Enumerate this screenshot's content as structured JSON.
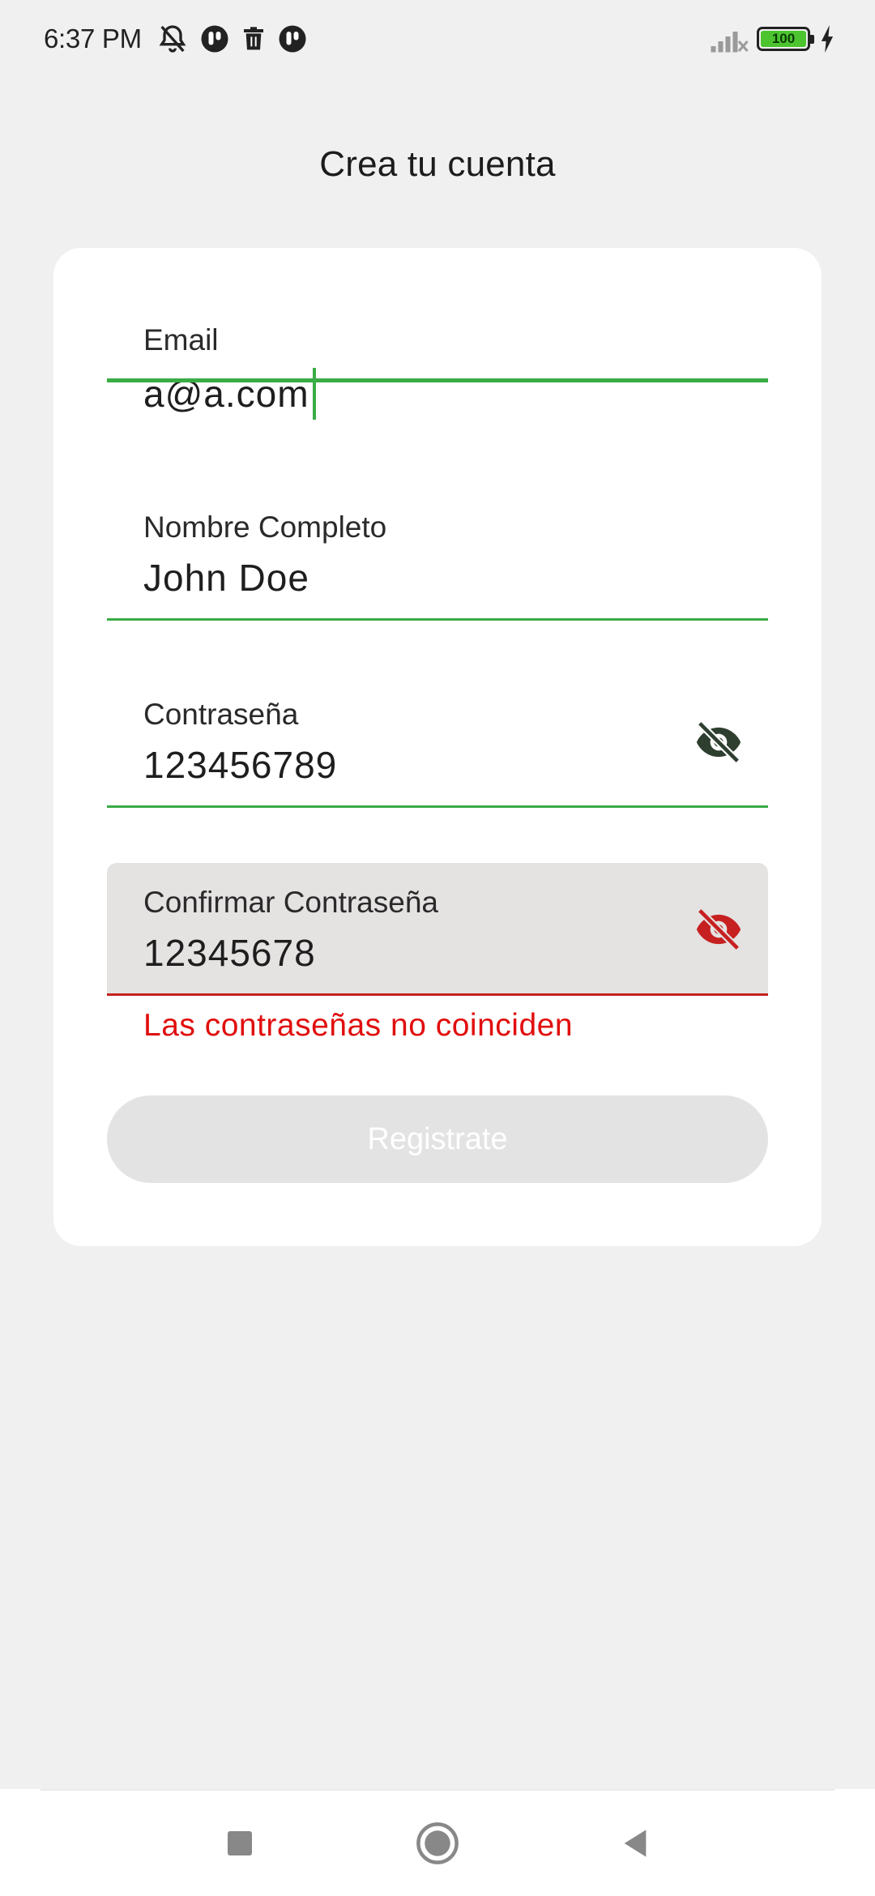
{
  "status_bar": {
    "time": "6:37 PM",
    "battery_level": "100",
    "icons": [
      "muted-bell-icon",
      "app-notification-icon",
      "trash-icon",
      "app-notification-icon",
      "signal-off-icon",
      "battery-icon",
      "charging-icon"
    ]
  },
  "page": {
    "title": "Crea tu cuenta"
  },
  "form": {
    "email": {
      "label": "Email",
      "value": "a@a.com"
    },
    "full_name": {
      "label": "Nombre Completo",
      "value": "John Doe"
    },
    "password": {
      "label": "Contraseña",
      "value": "123456789"
    },
    "confirm_password": {
      "label": "Confirmar Contraseña",
      "value": "12345678"
    },
    "error_message": "Las contraseñas no coinciden",
    "submit_label": "Registrate"
  },
  "colors": {
    "accent": "#3aac46",
    "error": "#e10e0e",
    "eye_normal": "#2f3f2f",
    "eye_error": "#c62020",
    "disabled_button": "#e3e3e3"
  },
  "nav_bar": {
    "icons": [
      "recents-square-icon",
      "home-circle-icon",
      "back-triangle-icon"
    ]
  }
}
